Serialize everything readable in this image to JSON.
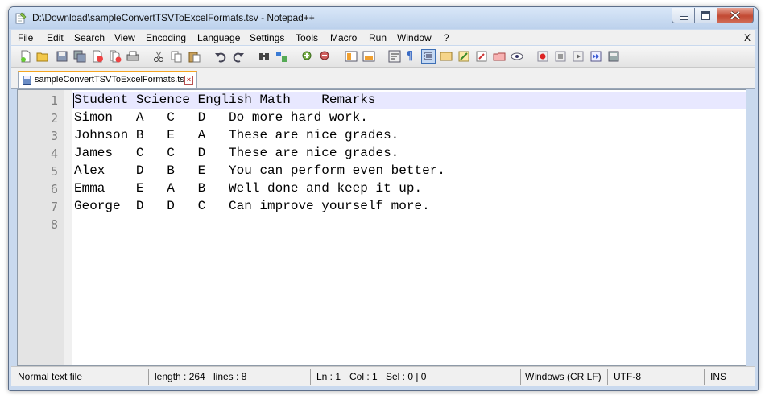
{
  "window": {
    "title": "D:\\Download\\sampleConvertTSVToExcelFormats.tsv - Notepad++"
  },
  "menu": {
    "items": [
      "File",
      "Edit",
      "Search",
      "View",
      "Encoding",
      "Language",
      "Settings",
      "Tools",
      "Macro",
      "Run",
      "Window",
      "?"
    ],
    "close_label": "X"
  },
  "tab": {
    "label": "sampleConvertTSVToExcelFormats.tsv"
  },
  "editor": {
    "line_numbers": [
      "1",
      "2",
      "3",
      "4",
      "5",
      "6",
      "7",
      "8"
    ],
    "lines": [
      "Student\tScience\tEnglish\tMath\tRemarks",
      "Simon\tA\tC\tD\tDo more hard work.",
      "Johnson\tB\tE\tA\tThese are nice grades.",
      "James\tC\tC\tD\tThese are nice grades.",
      "Alex\tD\tB\tE\tYou can perform even better.",
      "Emma\tE\tA\tB\tWell done and keep it up.",
      "George\tD\tD\tC\tCan improve yourself more.",
      ""
    ]
  },
  "status": {
    "file_type": "Normal text file",
    "length": "length : 264",
    "lines": "lines : 8",
    "ln": "Ln : 1",
    "col": "Col : 1",
    "sel": "Sel : 0 | 0",
    "eol": "Windows (CR LF)",
    "encoding": "UTF-8",
    "mode": "INS"
  }
}
